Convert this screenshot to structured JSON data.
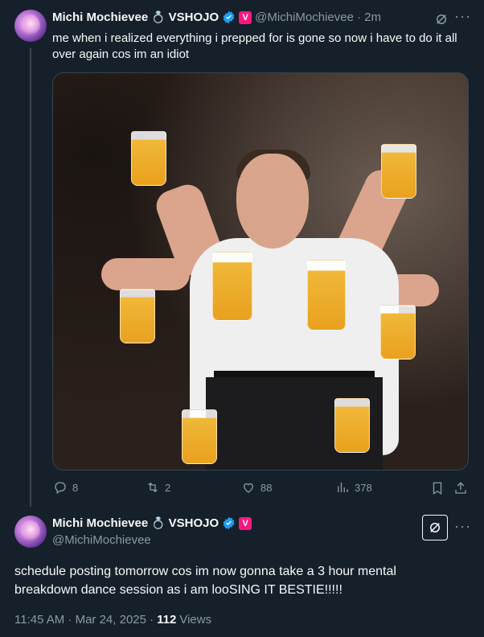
{
  "reply_tweet": {
    "author_name": "Michi Mochievee",
    "emoji": "💍",
    "affiliation": "VSHOJO",
    "affiliate_badge": "V",
    "handle": "@MichiMochievee",
    "time_ago": "· 2m",
    "text": "me when i realized everything i prepped for is gone so now i have to do it all over again cos im an idiot",
    "image_icon": "photo-people-holding-beers",
    "actions": {
      "replies": "8",
      "retweets": "2",
      "likes": "88",
      "views": "378"
    }
  },
  "main_tweet": {
    "author_name": "Michi Mochievee",
    "emoji": "💍",
    "affiliation": "VSHOJO",
    "affiliate_badge": "V",
    "handle": "@MichiMochievee",
    "text": "schedule posting tomorrow cos im now gonna take a 3 hour mental breakdown dance session as i am looSING IT BESTIE!!!!!",
    "time": "11:45 AM · Mar 24, 2025 ·",
    "views_count": "112",
    "views_label": "Views"
  },
  "colors": {
    "background": "#15202b",
    "text": "#f7f9f9",
    "muted": "#8b98a5",
    "verified": "#1d9bf0",
    "affiliate": "#f91880",
    "divider": "#38444d"
  }
}
